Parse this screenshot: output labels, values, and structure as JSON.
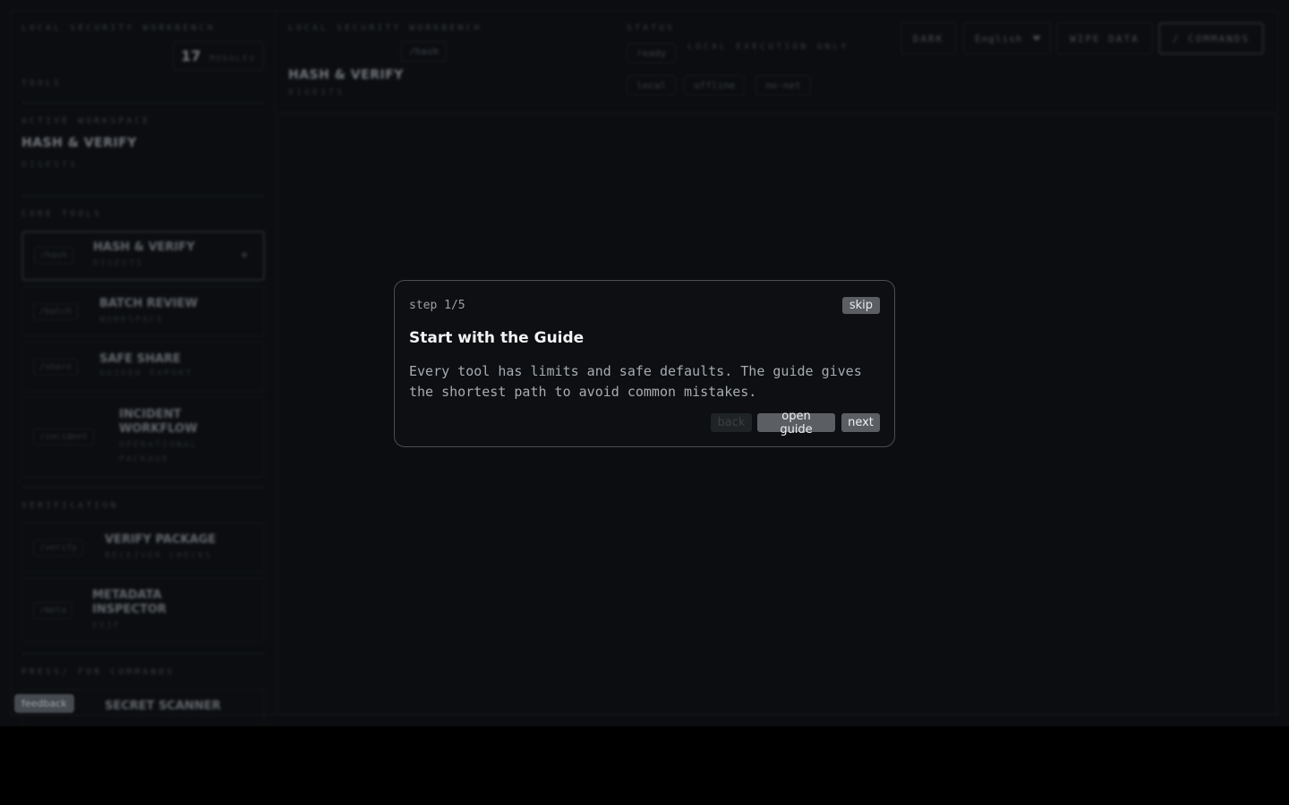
{
  "sidebar": {
    "app_title": "LOCAL SECURITY WORKBENCH",
    "module_count": "17",
    "module_label": "MODULES",
    "tools_label": "TOOLS",
    "active_label": "ACTIVE WORKSPACE",
    "active_name": "HASH & VERIFY",
    "active_sub": "DIGESTS",
    "sections": {
      "core": "CORE TOOLS",
      "verification": "VERIFICATION",
      "hint": "PRESS/ FOR COMMANDS"
    },
    "tools": [
      {
        "cmd": "/hash",
        "name": "HASH & VERIFY",
        "desc": "DIGESTS"
      },
      {
        "cmd": "/batch",
        "name": "BATCH REVIEW",
        "desc": "WORKSPACE"
      },
      {
        "cmd": "/share",
        "name": "SAFE SHARE",
        "desc": "GUIDED EXPORT"
      },
      {
        "cmd": "/incident",
        "name": "INCIDENT WORKFLOW",
        "desc": "OPERATIONAL PACKAGE"
      },
      {
        "cmd": "/verify",
        "name": "VERIFY PACKAGE",
        "desc": "RECEIVER CHECKS"
      },
      {
        "cmd": "/meta",
        "name": "METADATA INSPECTOR",
        "desc": "EXIF"
      },
      {
        "cmd": "/secret",
        "name": "SECRET SCANNER",
        "desc": ""
      }
    ]
  },
  "header": {
    "app_title": "LOCAL SECURITY WORKBENCH",
    "cmd_badge": "/hash",
    "title": "HASH & VERIFY",
    "subtitle": "DIGESTS",
    "status_label": "STATUS",
    "status_ready": "ready",
    "local_only": "LOCAL EXECUTION ONLY",
    "pills": [
      "local",
      "offline",
      "no-net"
    ],
    "theme_button": "DARK",
    "language": "English",
    "wipe_button": "WIPE DATA",
    "commands_button": "/ COMMANDS"
  },
  "feedback_label": "feedback",
  "modal": {
    "step": "step 1/5",
    "skip": "skip",
    "title": "Start with the Guide",
    "body": "Every tool has limits and safe defaults. The guide gives the shortest path to avoid common mistakes.",
    "back": "back",
    "open_guide": "open guide",
    "next": "next"
  }
}
